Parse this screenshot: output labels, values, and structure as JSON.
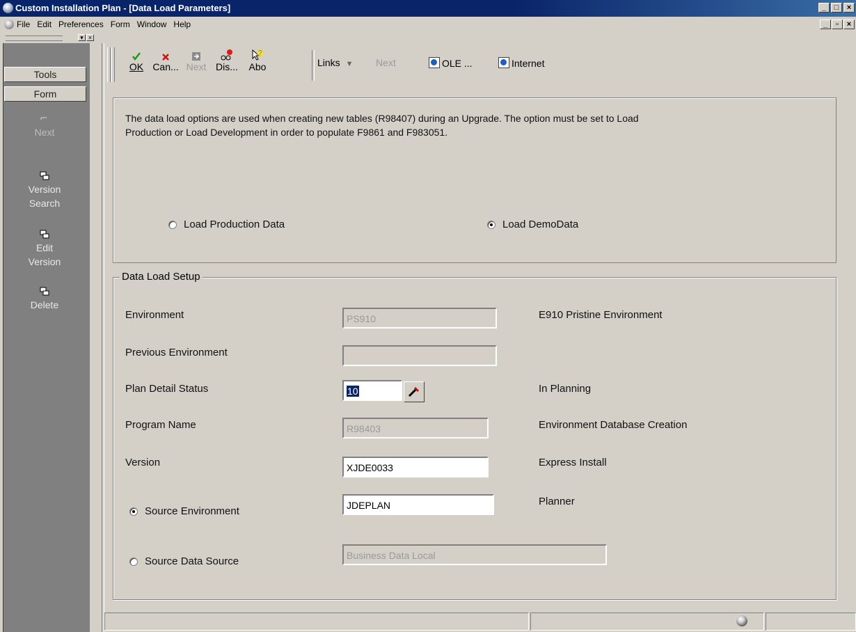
{
  "window": {
    "title": "Custom Installation Plan - [Data Load Parameters]",
    "controls": [
      "_",
      "□",
      "×"
    ]
  },
  "menubar": {
    "items": [
      "File",
      "Edit",
      "Preferences",
      "Form",
      "Window",
      "Help"
    ],
    "mdi_controls": [
      "_",
      "▫",
      "×"
    ]
  },
  "left_panel": {
    "tools_label": "Tools",
    "form_label": "Form",
    "items": [
      {
        "label": "Next",
        "icon": "next-arrow-icon",
        "enabled": false
      },
      {
        "label": "Version Search",
        "icon": "version-icon",
        "enabled": true
      },
      {
        "label": "Edit Version",
        "icon": "version-icon",
        "enabled": true
      },
      {
        "label": "Delete",
        "icon": "version-icon",
        "enabled": true
      }
    ]
  },
  "toolbar": {
    "buttons": [
      {
        "label": "OK",
        "icon": "checkmark-icon",
        "enabled": true
      },
      {
        "label": "Can...",
        "icon": "cancel-x-icon",
        "enabled": true
      },
      {
        "label": "Next",
        "icon": "next-arrow-icon",
        "enabled": false
      },
      {
        "label": "Dis...",
        "icon": "display-glasses-icon",
        "enabled": true
      },
      {
        "label": "Abo",
        "icon": "about-help-icon",
        "enabled": true
      }
    ],
    "links_label": "Links",
    "next_label": "Next",
    "ole_label": "OLE ...",
    "internet_label": "Internet"
  },
  "message": {
    "line1": "The data load options are used when creating new tables (R98407) during an Upgrade.  The option must be set to Load",
    "line2": "Production or Load Development in order to populate F9861 and F983051."
  },
  "data_load_options": {
    "production_label": "Load Production Data",
    "demo_label": "Load DemoData",
    "selected": "demo"
  },
  "setup": {
    "group_label": "Data Load Setup",
    "environment": {
      "label": "Environment",
      "value": "PS910",
      "desc": "E910 Pristine Environment"
    },
    "previous_environment": {
      "label": "Previous Environment",
      "value": ""
    },
    "plan_detail_status": {
      "label": "Plan Detail Status",
      "value": "10",
      "desc": "In Planning"
    },
    "program_name": {
      "label": "Program Name",
      "value": "R98403",
      "desc": "Environment Database Creation"
    },
    "version": {
      "label": "Version",
      "value": "XJDE0033",
      "desc": "Express Install"
    },
    "source_environment": {
      "label": "Source Environment",
      "value": "JDEPLAN",
      "desc": "Planner",
      "selected": true
    },
    "source_data_source": {
      "label": "Source Data Source",
      "value": "Business Data Local",
      "selected": false
    }
  }
}
